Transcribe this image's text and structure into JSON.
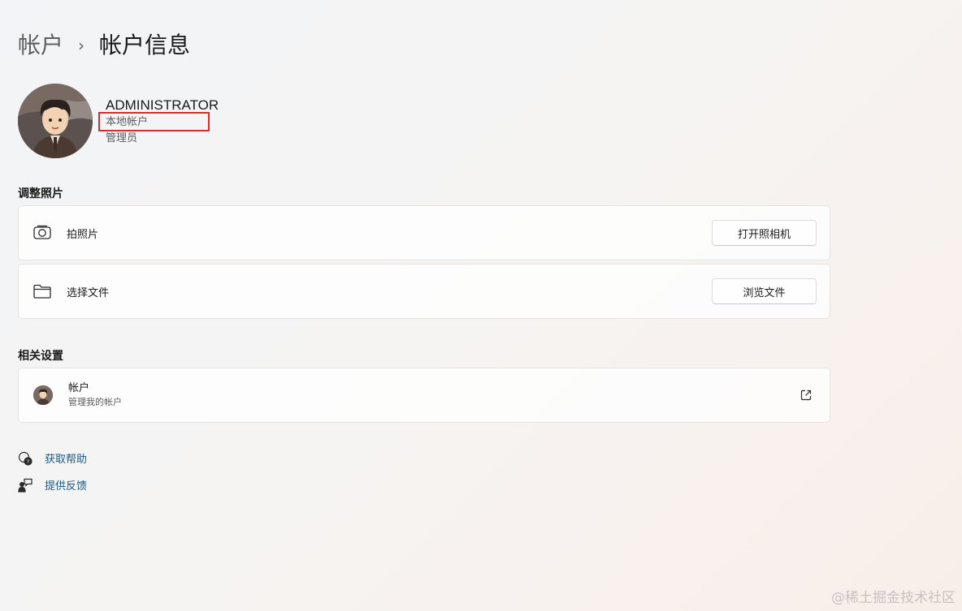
{
  "breadcrumb": {
    "parent": "帐户",
    "separator": "›",
    "current": "帐户信息"
  },
  "profile": {
    "name": "ADMINISTRATOR",
    "account_type": "本地帐户",
    "role": "管理员"
  },
  "adjust_photo": {
    "title": "调整照片",
    "items": [
      {
        "icon": "camera-icon",
        "label": "拍照片",
        "button": "打开照相机"
      },
      {
        "icon": "folder-icon",
        "label": "选择文件",
        "button": "浏览文件"
      }
    ]
  },
  "related": {
    "title": "相关设置",
    "account": {
      "title": "帐户",
      "subtitle": "管理我的帐户",
      "icon": "external-link-icon"
    }
  },
  "links": {
    "help": "获取帮助",
    "feedback": "提供反馈"
  },
  "watermark": "@稀土掘金技术社区",
  "colors": {
    "highlight": "#d92b2b",
    "link": "#1a5a86"
  }
}
